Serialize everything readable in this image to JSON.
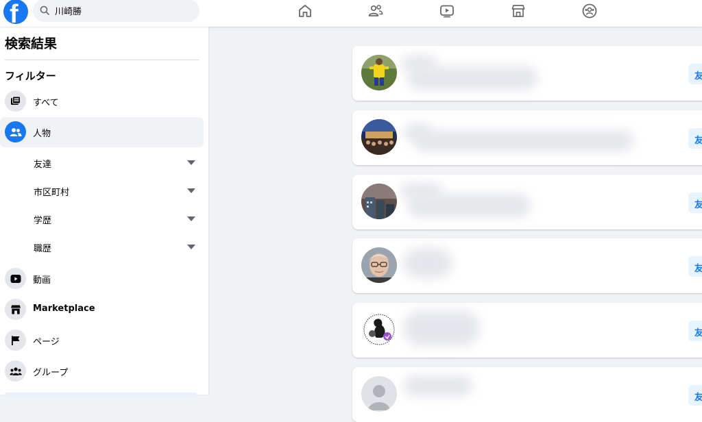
{
  "header": {
    "logo": "f",
    "search_value": "川崎勝",
    "nav_icons": [
      "home-icon",
      "friends-icon",
      "watch-icon",
      "marketplace-icon",
      "groups-icon"
    ]
  },
  "sidebar": {
    "title": "検索結果",
    "filter_heading": "フィルター",
    "items_top": [
      {
        "label": "すべて",
        "icon": "all-icon"
      },
      {
        "label": "人物",
        "icon": "people-icon",
        "selected": true
      }
    ],
    "people_subfilters": [
      {
        "label": "友達"
      },
      {
        "label": "市区町村"
      },
      {
        "label": "学歴"
      },
      {
        "label": "職歴"
      }
    ],
    "items_bottom": [
      {
        "label": "動画",
        "icon": "video-icon"
      },
      {
        "label": "Marketplace",
        "icon": "marketplace-icon"
      },
      {
        "label": "ページ",
        "icon": "flag-icon"
      },
      {
        "label": "グループ",
        "icon": "groups-icon"
      }
    ]
  },
  "results": {
    "add_friend_label": "友",
    "cards": [
      {
        "avatar": "person-in-yellow"
      },
      {
        "avatar": "crowd-at-night"
      },
      {
        "avatar": "building-dusk"
      },
      {
        "avatar": "man-with-glasses"
      },
      {
        "avatar": "dog-logo"
      },
      {
        "avatar": "default-silhouette"
      }
    ]
  },
  "colors": {
    "brand": "#1877f2",
    "page_bg": "#f0f2f5",
    "surface": "#ffffff",
    "button_bg": "#e7f3ff"
  }
}
